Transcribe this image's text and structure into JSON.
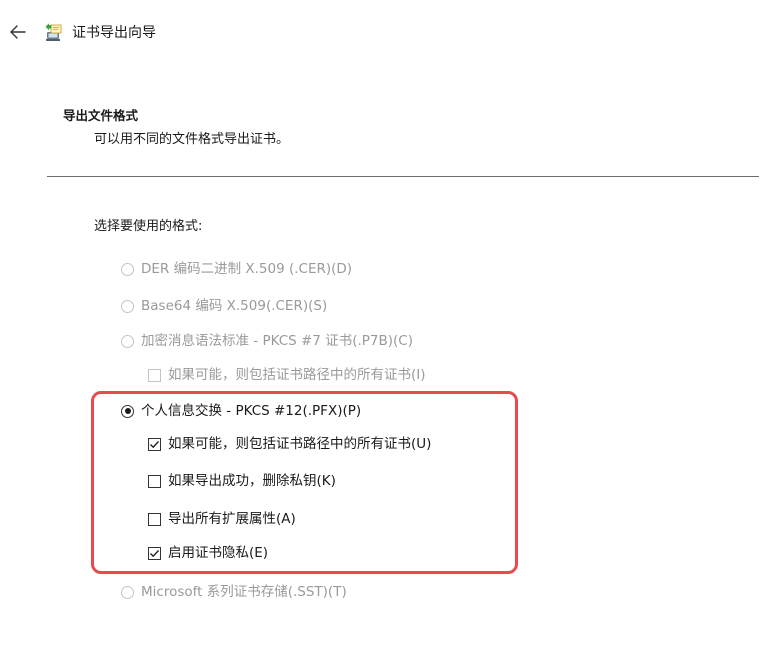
{
  "header": {
    "title": "证书导出向导",
    "back_icon": "back-arrow-icon",
    "wizard_icon": "certificate-wizard-icon"
  },
  "section": {
    "title": "导出文件格式",
    "subtitle": "可以用不同的文件格式导出证书。"
  },
  "prompt": "选择要使用的格式:",
  "options": {
    "der": {
      "label": "DER 编码二进制 X.509 (.CER)(D)",
      "enabled": false,
      "selected": false
    },
    "base64": {
      "label": "Base64 编码 X.509(.CER)(S)",
      "enabled": false,
      "selected": false
    },
    "pkcs7": {
      "label": "加密消息语法标准 - PKCS #7 证书(.P7B)(C)",
      "enabled": false,
      "selected": false
    },
    "pkcs7_include_all": {
      "label": "如果可能，则包括证书路径中的所有证书(I)",
      "enabled": false,
      "checked": false
    },
    "pfx": {
      "label": "个人信息交换 - PKCS #12(.PFX)(P)",
      "enabled": true,
      "selected": true
    },
    "pfx_include_all": {
      "label": "如果可能，则包括证书路径中的所有证书(U)",
      "enabled": true,
      "checked": true
    },
    "pfx_delete_key": {
      "label": "如果导出成功，删除私钥(K)",
      "enabled": true,
      "checked": false
    },
    "pfx_export_ext": {
      "label": "导出所有扩展属性(A)",
      "enabled": true,
      "checked": false
    },
    "pfx_privacy": {
      "label": "启用证书隐私(E)",
      "enabled": true,
      "checked": true
    },
    "sst": {
      "label": "Microsoft 系列证书存储(.SST)(T)",
      "enabled": false,
      "selected": false
    }
  },
  "colors": {
    "highlight": "#e84a4f",
    "disabled_text": "#9a9a9a",
    "text": "#1a1a1a"
  }
}
